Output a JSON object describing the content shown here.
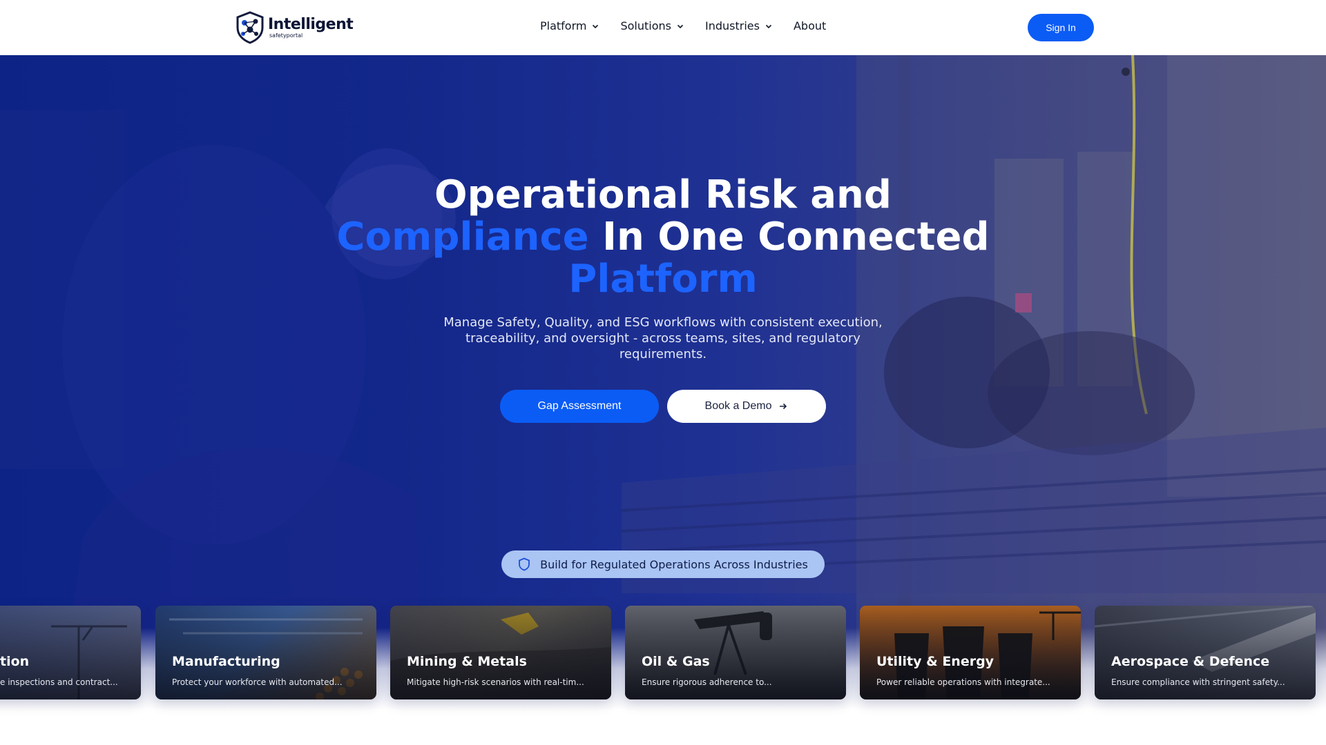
{
  "nav": {
    "logo": {
      "name": "Intelligent",
      "sub": "safetyportal"
    },
    "menu": [
      {
        "label": "Platform",
        "dropdown": true
      },
      {
        "label": "Solutions",
        "dropdown": true
      },
      {
        "label": "Industries",
        "dropdown": true
      },
      {
        "label": "About",
        "dropdown": false
      }
    ],
    "sign_in": "Sign In"
  },
  "hero": {
    "headline_line1": "Operational Risk and",
    "headline_highlight1": "Compliance",
    "headline_line2": " In One Connected",
    "headline_highlight2": "Platform",
    "subtext": "Manage Safety, Quality, and ESG workflows with consistent execution, traceability, and oversight - across teams, sites, and regulatory requirements.",
    "cta_primary": "Gap Assessment",
    "cta_secondary": "Book a Demo",
    "badge": "Build for Regulated Operations Across Industries"
  },
  "industries": [
    {
      "title": "tion",
      "desc": "e inspections and contract..."
    },
    {
      "title": "Manufacturing",
      "desc": "Protect your workforce with automated..."
    },
    {
      "title": "Mining & Metals",
      "desc": "Mitigate high-risk scenarios with real-tim..."
    },
    {
      "title": "Oil & Gas",
      "desc": "Ensure rigorous adherence to..."
    },
    {
      "title": "Utility & Energy",
      "desc": "Power reliable operations with integrate..."
    },
    {
      "title": "Aerospace & Defence",
      "desc": "Ensure compliance with stringent safety..."
    }
  ],
  "colors": {
    "accent": "#0b5cf5",
    "highlight": "#1d63ff",
    "hero_overlay": "#13278a",
    "badge_bg": "#aac4f3",
    "nav_text": "#111827"
  }
}
